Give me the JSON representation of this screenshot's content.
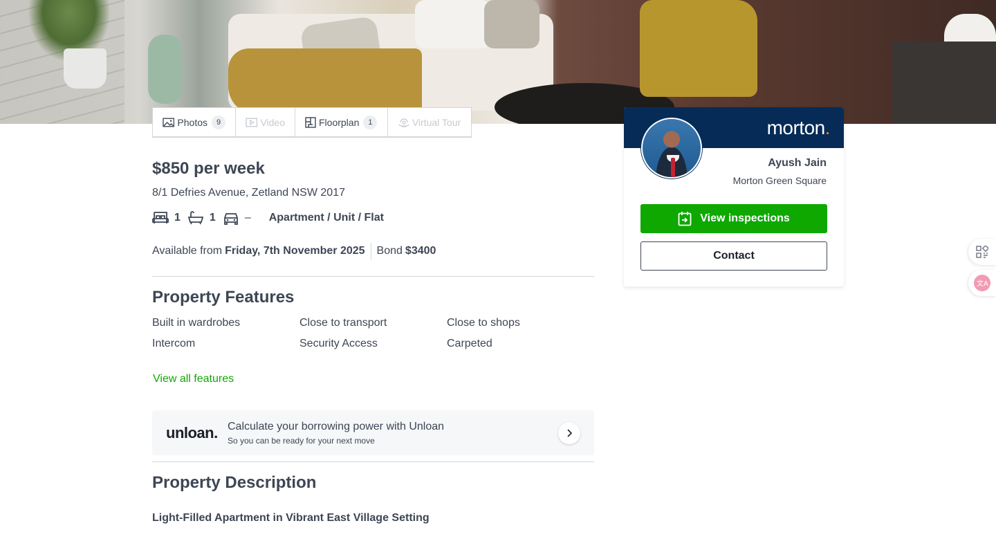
{
  "media_tabs": [
    {
      "label": "Photos",
      "count": "9"
    },
    {
      "label": "Video"
    },
    {
      "label": "Floorplan",
      "count": "1"
    },
    {
      "label": "Virtual Tour"
    }
  ],
  "listing": {
    "price": "$850 per week",
    "address": "8/1 Defries Avenue, Zetland NSW 2017",
    "beds": "1",
    "baths": "1",
    "parking": "–",
    "property_type": "Apartment / Unit / Flat",
    "available_label": "Available from",
    "available_date": "Friday, 7th November 2025",
    "bond_label": "Bond",
    "bond_value": "$3400"
  },
  "features": {
    "title": "Property Features",
    "items": [
      "Built in wardrobes",
      "Close to transport",
      "Close to shops",
      "Intercom",
      "Security Access",
      "Carpeted"
    ],
    "view_all": "View all features"
  },
  "unloan": {
    "logo": "unloan.",
    "title": "Calculate your borrowing power with Unloan",
    "subtitle": "So you can be ready for your next move"
  },
  "description": {
    "title": "Property Description",
    "heading": "Light-Filled Apartment in Vibrant East Village Setting"
  },
  "agent": {
    "agency_logo": "morton",
    "name": "Ayush Jain",
    "agency": "Morton Green Square",
    "inspect_label": "View inspections",
    "contact_label": "Contact"
  },
  "colors": {
    "primary_green": "#0ea800",
    "agency_navy": "#072b57",
    "text": "#3d4654",
    "accent_orange": "#f58220"
  },
  "icons": [
    "photo-icon",
    "video-icon",
    "floorplan-icon",
    "virtual-tour-icon",
    "bed-icon",
    "bath-icon",
    "car-icon",
    "calendar-icon",
    "chevron-right-icon",
    "qr-icon",
    "translate-icon"
  ]
}
